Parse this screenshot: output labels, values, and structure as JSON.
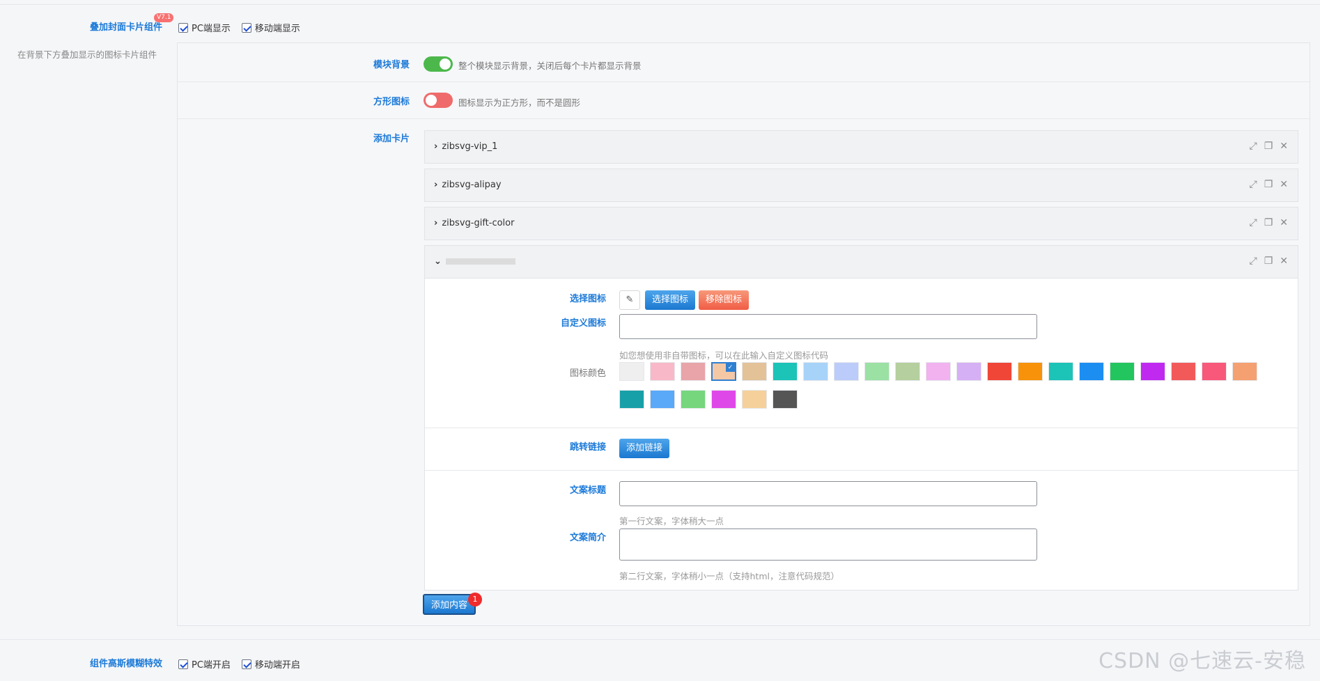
{
  "overlay_section": {
    "title": "叠加封面卡片组件",
    "badge": "V7.1",
    "description": "在背景下方叠加显示的图标卡片组件",
    "pc_label": "PC端显示",
    "mobile_label": "移动端显示"
  },
  "module_bg": {
    "label": "模块背景",
    "hint": "整个模块显示背景，关闭后每个卡片都显示背景",
    "on": true,
    "on_color": "#4cb84b"
  },
  "square_icon": {
    "label": "方形图标",
    "hint": "图标显示为正方形，而不是圆形",
    "on": false,
    "off_color": "#ef6b6b"
  },
  "add_cards": {
    "label": "添加卡片",
    "items": [
      {
        "title": "zibsvg-vip_1"
      },
      {
        "title": "zibsvg-alipay"
      },
      {
        "title": "zibsvg-gift-color"
      }
    ]
  },
  "card_editor": {
    "select_icon_label": "选择图标",
    "select_icon_button": "选择图标",
    "remove_icon_button": "移除图标",
    "custom_icon_label": "自定义图标",
    "custom_icon_hint": "如您想使用非自带图标，可以在此输入自定义图标代码",
    "icon_color_label": "图标颜色",
    "swatches": [
      "#efefef",
      "#f9b8c7",
      "#e8a4a8",
      "#f4c7a5",
      "#e3c298",
      "#1cc3b7",
      "#a8d3f9",
      "#bcccfa",
      "#9be1a4",
      "#b5cf9e",
      "#f1b2ef",
      "#d6b0f5",
      "#f04638",
      "#f7920a",
      "#1cc3b7",
      "#1c8ef2",
      "#22c55e",
      "#c02af0",
      "#f25a5a",
      "#f8587a",
      "#f5a070",
      "#18a0a8",
      "#5aa8f8",
      "#75d67e",
      "#df48e8",
      "#f5d09a",
      "#555555"
    ],
    "selected_swatch": 3,
    "link_label": "跳转链接",
    "add_link_button": "添加链接",
    "title_label": "文案标题",
    "title_hint": "第一行文案，字体稍大一点",
    "desc_label": "文案简介",
    "desc_hint": "第二行文案，字体稍小一点（支持html，注意代码规范）"
  },
  "add_content": {
    "label": "添加内容",
    "count": "1"
  },
  "blur_section": {
    "title": "组件高斯模糊特效",
    "pc_label": "PC端开启",
    "mobile_label": "移动端开启"
  },
  "watermark": "CSDN @七速云-安稳"
}
